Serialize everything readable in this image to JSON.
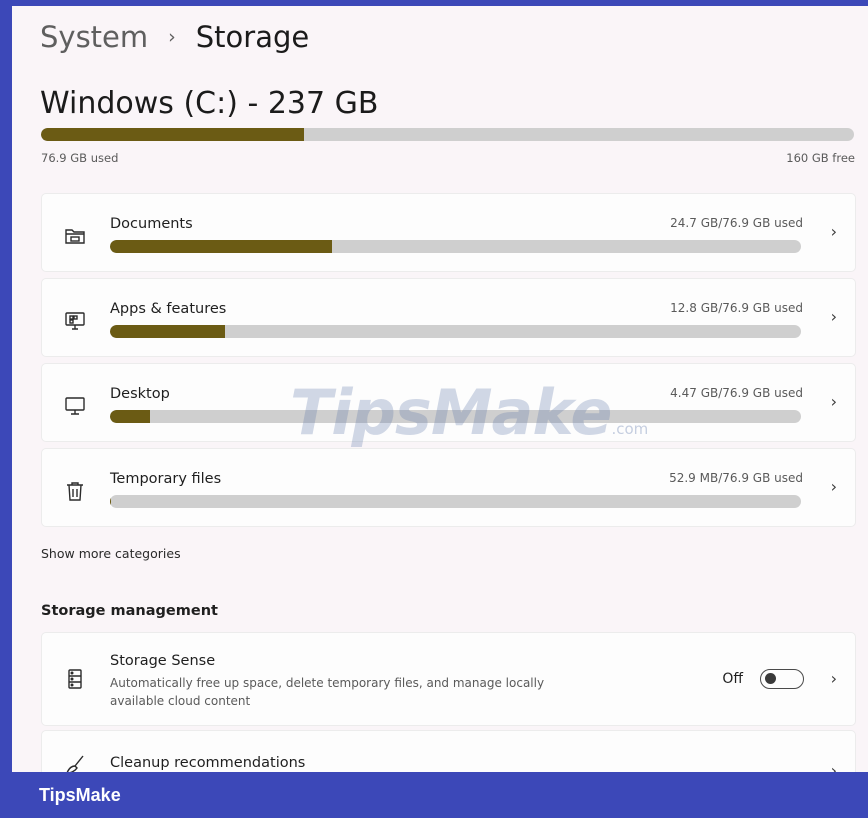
{
  "breadcrumb": {
    "parent": "System",
    "separator": "›",
    "current": "Storage"
  },
  "drive": {
    "title": "Windows (C:) - 237 GB",
    "used_label": "76.9 GB used",
    "free_label": "160 GB free",
    "used_fraction": 0.324
  },
  "categories": [
    {
      "label": "Documents",
      "size": "24.7 GB/76.9 GB used",
      "icon": "folder-icon",
      "fraction": 0.321
    },
    {
      "label": "Apps & features",
      "size": "12.8 GB/76.9 GB used",
      "icon": "apps-icon",
      "fraction": 0.166
    },
    {
      "label": "Desktop",
      "size": "4.47 GB/76.9 GB used",
      "icon": "monitor-icon",
      "fraction": 0.058
    },
    {
      "label": "Temporary files",
      "size": "52.9 MB/76.9 GB used",
      "icon": "trash-icon",
      "fraction": 0.0007
    }
  ],
  "show_more": "Show more categories",
  "management": {
    "title": "Storage management",
    "storage_sense": {
      "title": "Storage Sense",
      "description": "Automatically free up space, delete temporary files, and manage locally available cloud content",
      "toggle_state": "Off"
    },
    "cleanup": {
      "title": "Cleanup recommendations"
    }
  },
  "watermark": {
    "text": "TipsMake",
    "suffix": ".com"
  },
  "footer": {
    "brand": "TipsMake"
  },
  "colors": {
    "bar_fill": "#6b5b14",
    "bar_track": "#cfcfcf",
    "frame": "#3c48b8"
  }
}
